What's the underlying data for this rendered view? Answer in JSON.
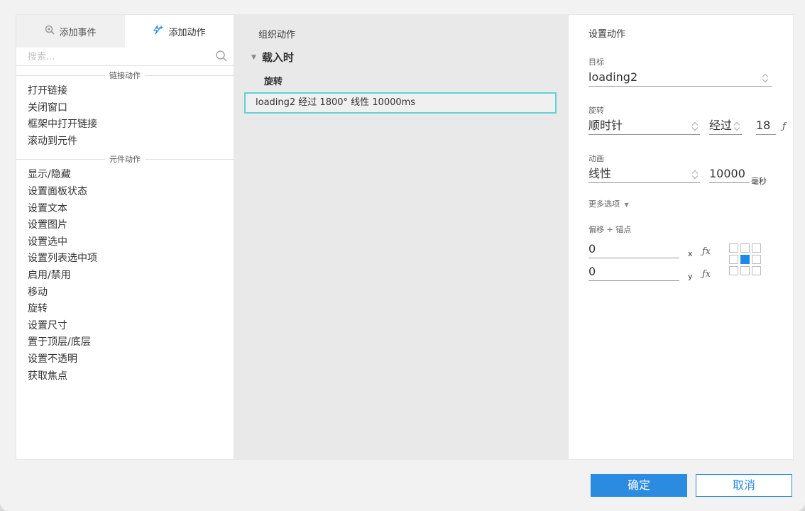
{
  "left_panel": {
    "tabs": [
      {
        "label": "添加事件",
        "icon": "gear-search-icon"
      },
      {
        "label": "添加动作",
        "icon": "lightning-plus-icon"
      }
    ],
    "search_placeholder": "搜索...",
    "groups": [
      {
        "title": "链接动作",
        "items": [
          "打开链接",
          "关闭窗口",
          "框架中打开链接",
          "滚动到元件"
        ]
      },
      {
        "title": "元件动作",
        "items": [
          "显示/隐藏",
          "设置面板状态",
          "设置文本",
          "设置图片",
          "设置选中",
          "设置列表选中项",
          "启用/禁用",
          "移动",
          "旋转",
          "设置尺寸",
          "置于顶层/底层",
          "设置不透明",
          "获取焦点"
        ]
      }
    ]
  },
  "middle_panel": {
    "title": "组织动作",
    "event": "载入时",
    "case": "旋转",
    "action_text": "loading2 经过 1800° 线性 10000ms"
  },
  "right_panel": {
    "title": "设置动作",
    "target_label": "目标",
    "target_value": "loading2",
    "rotate_label": "旋转",
    "direction_value": "顺时针",
    "via_value": "经过",
    "degree_value": "18",
    "degree_fx": "ƒ",
    "animation_label": "动画",
    "easing_value": "线性",
    "duration_value": "10000",
    "duration_unit": "毫秒",
    "more_options": "更多选项",
    "offset_label": "偏移 + 锚点",
    "offset_x": "0",
    "offset_y": "0",
    "x_label": "x",
    "y_label": "y",
    "fx_label": "ƒx",
    "anchor_selected_index": 4,
    "accent_color": "#2a8be0"
  },
  "buttons": {
    "ok": "确定",
    "cancel": "取消"
  }
}
